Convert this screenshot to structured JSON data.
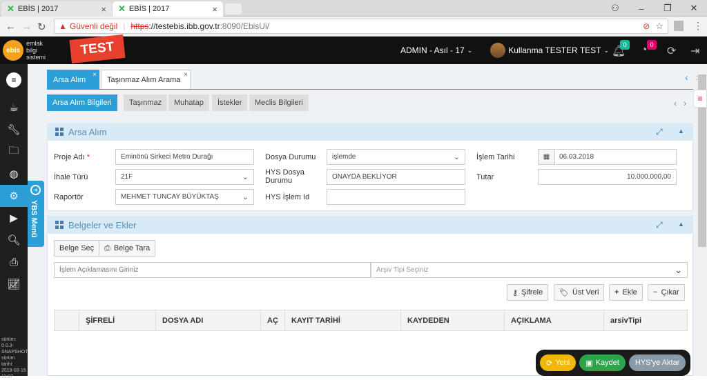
{
  "browser": {
    "tabs": [
      {
        "title": "EBİS | 2017"
      },
      {
        "title": "EBİS | 2017"
      }
    ],
    "security_label": "Güvenli değil",
    "url_scheme": "https",
    "url_host": "://testebis.ibb.gov.tr",
    "url_path": ":8090/EbisUi/"
  },
  "app": {
    "logo_text": "ebis",
    "logo_lines": [
      "emlak",
      "bilgi",
      "sistemi"
    ],
    "test_flag": "TEST",
    "role": "ADMIN - Asıl - 17",
    "user": "Kullanma TESTER TEST",
    "badge_notifications": "0",
    "badge_tasks": "0",
    "version_lines": [
      "sürüm:",
      "0.0.3-",
      "SNAPSHOT",
      "sürüm tarihi:",
      "2018-03-15",
      "11:07"
    ],
    "ybs_menu": "YBS Menü"
  },
  "page_tabs": [
    {
      "label": "Arsa Alım"
    },
    {
      "label": "Taşınmaz Alım Arama"
    }
  ],
  "sub_tabs": [
    {
      "label": "Arsa Alım Bilgileri"
    },
    {
      "label": "Taşınmaz"
    },
    {
      "label": "Muhatap"
    },
    {
      "label": "İstekler"
    },
    {
      "label": "Meclis Bilgileri"
    }
  ],
  "arsa_panel": {
    "title": "Arsa Alım",
    "proje_adi_label": "Proje Adı",
    "proje_adi": "Eminönü Sirkeci Metro Durağı",
    "ihale_turu_label": "İhale Türü",
    "ihale_turu": "21F",
    "raportor_label": "Raportör",
    "raportor": "MEHMET TUNCAY BÜYÜKTAŞ",
    "dosya_durumu_label": "Dosya Durumu",
    "dosya_durumu": "işlemde",
    "hys_dosya_label_1": "HYS Dosya",
    "hys_dosya_label_2": "Durumu",
    "hys_dosya": "ONAYDA BEKLİYOR",
    "hys_islem_label": "HYS İşlem Id",
    "hys_islem": "",
    "islem_tarihi_label": "İşlem Tarihi",
    "islem_tarihi": "06.03.2018",
    "tutar_label": "Tutar",
    "tutar": "10.000.000,00"
  },
  "belgeler_panel": {
    "title": "Belgeler ve Ekler",
    "belge_sec": "Belge Seç",
    "belge_tara": "Belge Tara",
    "aciklama_placeholder": "İşlem Açıklamasını Giriniz",
    "arsiv_placeholder": "Arşiv Tipi Seçiniz",
    "sifrele": "Şifrele",
    "ust_veri": "Üst Veri",
    "ekle": "Ekle",
    "cikar": "Çıkar",
    "columns": [
      "ŞİFRELİ",
      "DOSYA ADI",
      "AÇ",
      "KAYIT TARİHİ",
      "KAYDEDEN",
      "AÇIKLAMA",
      "arsivTipi"
    ]
  },
  "actions": {
    "yeni": "Yeni",
    "kaydet": "Kaydet",
    "hys_aktar": "HYS'ye Aktar"
  },
  "colors": {
    "accent": "#2b9fd6",
    "test_flag": "#e8402e",
    "yeni": "#f2b705",
    "kaydet": "#2fa34a",
    "hys": "#8a9aa6"
  }
}
